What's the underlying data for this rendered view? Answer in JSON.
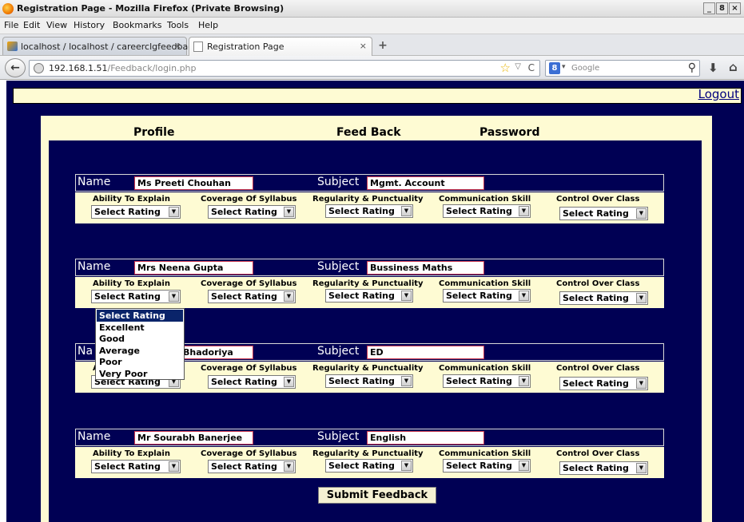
{
  "window": {
    "title": "Registration Page - Mozilla Firefox (Private Browsing)",
    "controls": [
      "_",
      "8",
      "×"
    ]
  },
  "menu": [
    "File",
    "Edit",
    "View",
    "History",
    "Bookmarks",
    "Tools",
    "Help"
  ],
  "tabs": [
    {
      "label": "localhost / localhost / careerclgfeedback ...",
      "close": "×"
    },
    {
      "label": "Registration Page",
      "close": "×"
    }
  ],
  "newtab": "+",
  "nav": {
    "url_host": "192.168.1.51",
    "url_path": "/Feedback/login.php",
    "search_placeholder": "Google",
    "search_engine_letter": "8"
  },
  "page": {
    "logout": "Logout",
    "nav_links": [
      "Profile",
      "Feed Back",
      "Password"
    ],
    "name_label": "Name",
    "subject_label": "Subject",
    "criteria": [
      "Ability To Explain",
      "Coverage Of Syllabus",
      "Regularity & Punctuality",
      "Communication Skill",
      "Control Over Class"
    ],
    "select_default": "Select Rating",
    "teachers": [
      {
        "name": "Ms Preeti Chouhan",
        "subject": "Mgmt. Account"
      },
      {
        "name": "Mrs Neena Gupta",
        "subject": "Bussiness Maths"
      },
      {
        "name": "Mrs Neha Bhadoriya",
        "name_visible": "Na",
        "name_field_visible": "Bhadoriya",
        "subject": "ED"
      },
      {
        "name": "Mr Sourabh Banerjee",
        "subject": "English"
      }
    ],
    "dropdown_options": [
      "Select Rating",
      "Excellent",
      "Good",
      "Average",
      "Poor",
      "Very Poor"
    ],
    "submit": "Submit Feedback"
  }
}
